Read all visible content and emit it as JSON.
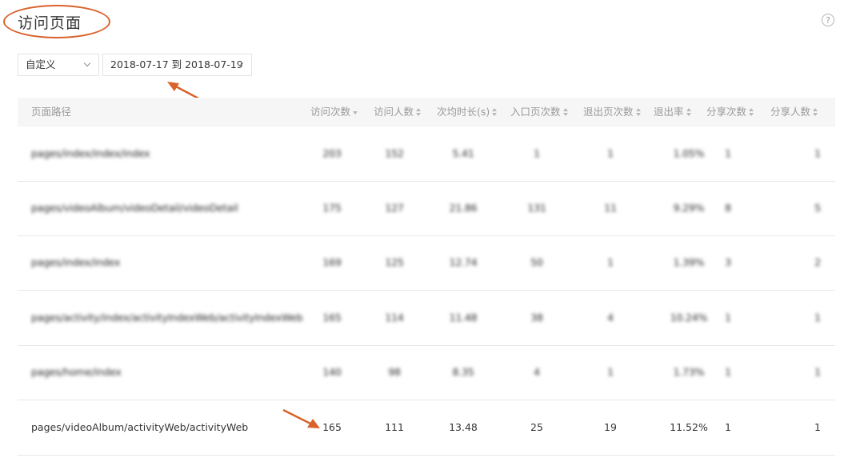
{
  "page": {
    "title": "访问页面",
    "help_icon": "question-circle-icon",
    "help_glyph": "?"
  },
  "filters": {
    "range_label": "自定义",
    "date_range": "2018-07-17 到 2018-07-19"
  },
  "annotation_color": "#d9622b",
  "table": {
    "columns": [
      {
        "label": "页面路径",
        "sort": "none"
      },
      {
        "label": "访问次数",
        "sort": "desc"
      },
      {
        "label": "访问人数",
        "sort": "both"
      },
      {
        "label": "次均时长(s)",
        "sort": "both"
      },
      {
        "label": "入口页次数",
        "sort": "both"
      },
      {
        "label": "退出页次数",
        "sort": "both"
      },
      {
        "label": "退出率",
        "sort": "both"
      },
      {
        "label": "分享次数",
        "sort": "both"
      },
      {
        "label": "分享人数",
        "sort": "both"
      }
    ],
    "rows": [
      {
        "blurred": true,
        "cells": [
          "pages/index/index/index",
          "203",
          "152",
          "5.41",
          "1",
          "1",
          "1.05%",
          "1",
          "1"
        ]
      },
      {
        "blurred": true,
        "cells": [
          "pages/videoAlbum/videoDetail/videoDetail",
          "175",
          "127",
          "21.86",
          "131",
          "11",
          "9.29%",
          "8",
          "5"
        ]
      },
      {
        "blurred": true,
        "cells": [
          "pages/index/index",
          "169",
          "125",
          "12.74",
          "50",
          "1",
          "1.39%",
          "3",
          "2"
        ]
      },
      {
        "blurred": true,
        "cells": [
          "pages/activity/index/activityIndexWeb/activityIndexWeb",
          "165",
          "114",
          "11.48",
          "38",
          "4",
          "10.24%",
          "1",
          "1"
        ]
      },
      {
        "blurred": true,
        "cells": [
          "pages/home/index",
          "140",
          "98",
          "8.35",
          "4",
          "1",
          "1.73%",
          "1",
          "1"
        ]
      },
      {
        "blurred": false,
        "cells": [
          "pages/videoAlbum/activityWeb/activityWeb",
          "165",
          "111",
          "13.48",
          "25",
          "19",
          "11.52%",
          "1",
          "1"
        ]
      }
    ]
  }
}
